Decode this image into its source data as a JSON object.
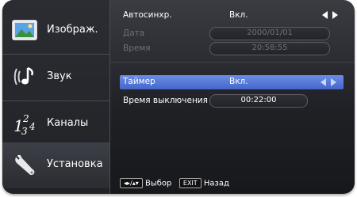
{
  "sidebar": {
    "items": [
      {
        "label": "Изображ.",
        "icon": "picture-icon"
      },
      {
        "label": "Звук",
        "icon": "music-note-icon"
      },
      {
        "label": "Каналы",
        "icon": "channels-icon"
      },
      {
        "label": "Установка",
        "icon": "wrench-icon"
      }
    ],
    "channels_digits": [
      "1",
      "2",
      "3",
      "4"
    ]
  },
  "settings": {
    "autosync": {
      "label": "Автосинхр.",
      "value": "Вкл."
    },
    "date": {
      "label": "Дата",
      "value": "2000/01/01"
    },
    "time": {
      "label": "Время",
      "value": "20:58:55"
    },
    "timer": {
      "label": "Таймер",
      "value": "Вкл."
    },
    "off_time": {
      "label": "Время выключения",
      "value": "00:22:00"
    }
  },
  "help": {
    "select_label": "Выбор",
    "exit_key": "EXIT",
    "back_label": "Назад"
  },
  "colors": {
    "highlight": "#5577d8"
  }
}
